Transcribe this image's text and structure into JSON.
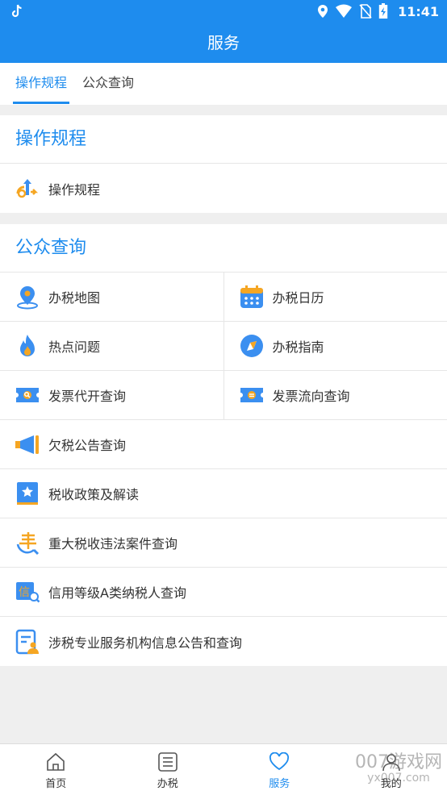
{
  "status_bar": {
    "time": "11:41"
  },
  "header": {
    "title": "服务"
  },
  "tabs": [
    {
      "label": "操作规程",
      "active": true
    },
    {
      "label": "公众查询",
      "active": false
    }
  ],
  "sections": {
    "procedure": {
      "title": "操作规程",
      "items": [
        {
          "label": "操作规程",
          "icon": "arrows-procedure-icon"
        }
      ]
    },
    "public_query": {
      "title": "公众查询",
      "grid": [
        {
          "label": "办税地图",
          "icon": "map-pin-icon"
        },
        {
          "label": "办税日历",
          "icon": "calendar-icon"
        },
        {
          "label": "热点问题",
          "icon": "flame-icon"
        },
        {
          "label": "办税指南",
          "icon": "compass-icon"
        },
        {
          "label": "发票代开查询",
          "icon": "invoice-search-icon"
        },
        {
          "label": "发票流向查询",
          "icon": "invoice-flow-icon"
        }
      ],
      "list": [
        {
          "label": "欠税公告查询",
          "icon": "megaphone-icon"
        },
        {
          "label": "税收政策及解读",
          "icon": "policy-book-icon"
        },
        {
          "label": "重大税收违法案件查询",
          "icon": "violation-search-icon"
        },
        {
          "label": "信用等级A类纳税人查询",
          "icon": "credit-search-icon"
        },
        {
          "label": "涉税专业服务机构信息公告和查询",
          "icon": "agency-info-icon"
        }
      ]
    }
  },
  "bottom_nav": [
    {
      "label": "首页",
      "icon": "home-icon",
      "active": false
    },
    {
      "label": "办税",
      "icon": "list-icon",
      "active": false
    },
    {
      "label": "服务",
      "icon": "heart-icon",
      "active": true
    },
    {
      "label": "我的",
      "icon": "user-icon",
      "active": false
    }
  ],
  "watermark": {
    "main": "007游戏网",
    "sub": "yx007.com"
  },
  "colors": {
    "primary": "#1e8cee",
    "accent_orange": "#f5a623",
    "background": "#efefef"
  }
}
